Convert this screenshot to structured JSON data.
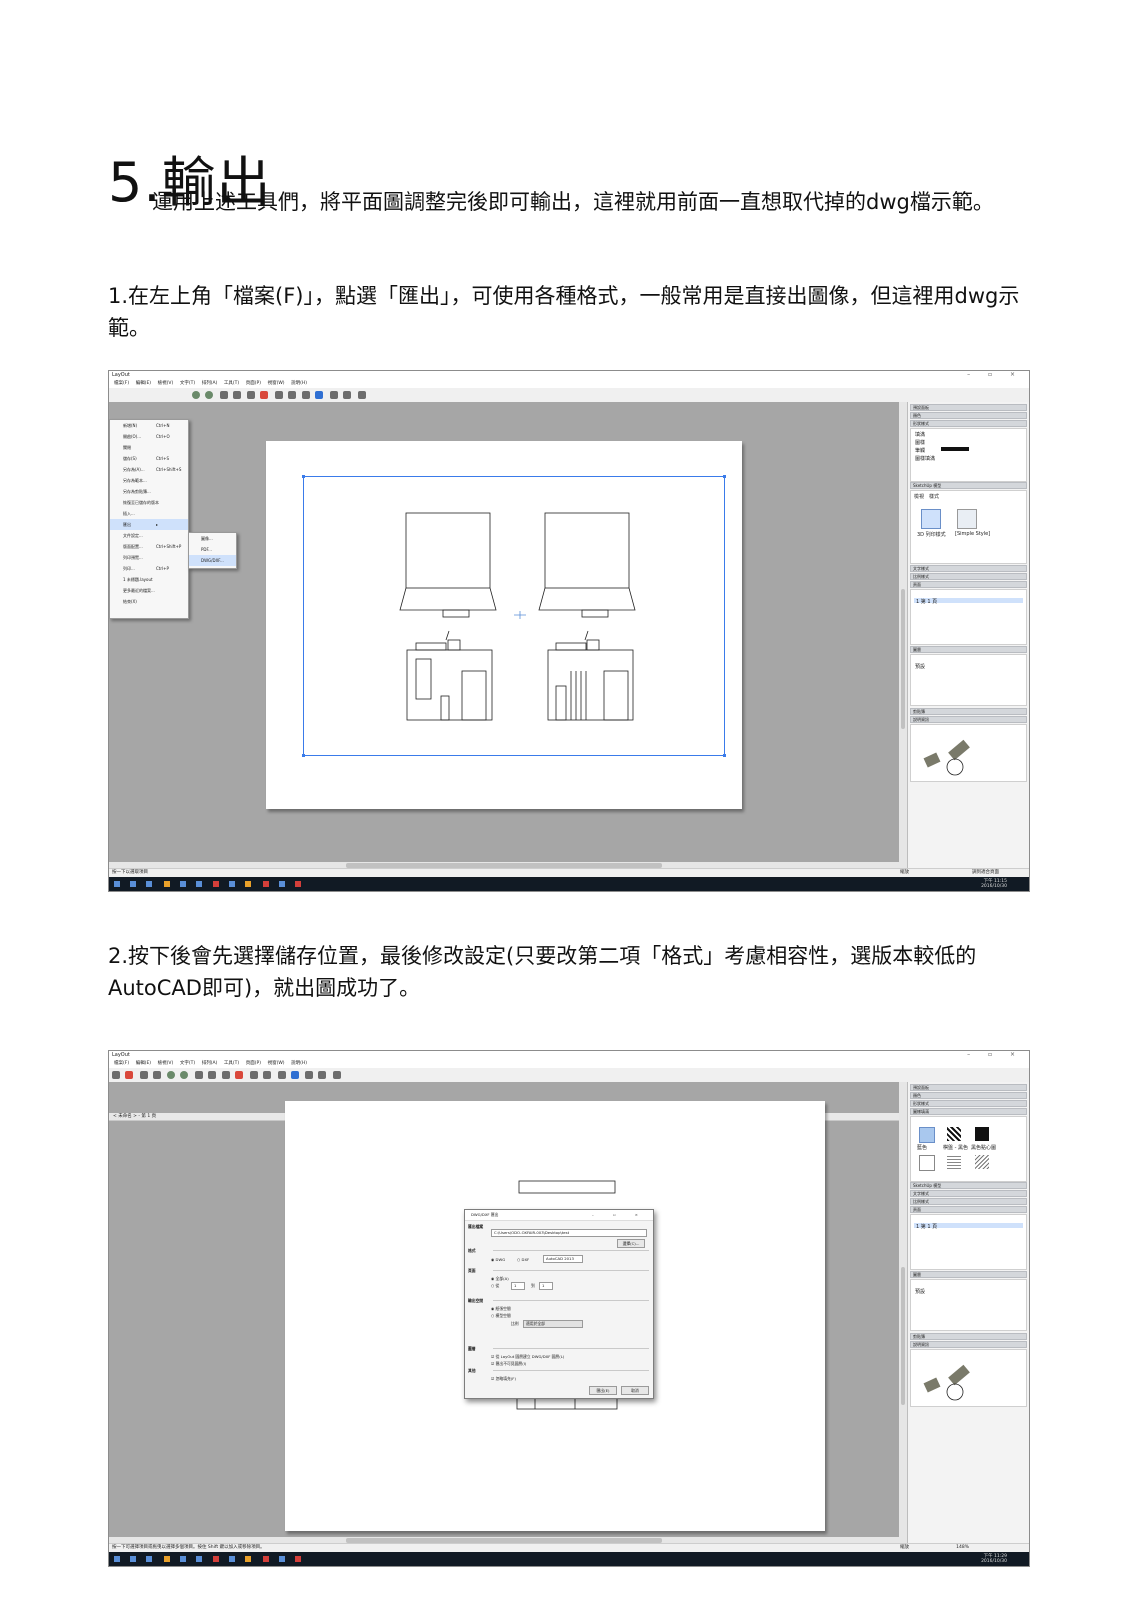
{
  "heading": "5.輸出",
  "paragraphs": {
    "intro": "運用上述工具們，將平面圖調整完後即可輸出，這裡就用前面一直想取代掉的dwg檔示範。",
    "step1": "1.在左上角「檔案(F)」，點選「匯出」，可使用各種格式，一般常用是直接出圖像，但這裡用dwg示範。",
    "step2": "2.按下後會先選擇儲存位置，最後修改設定(只要改第二項「格式」考慮相容性，選版本較低的AutoCAD即可)，就出圖成功了。"
  },
  "screenshot1": {
    "app_title": "LayOut",
    "menu": [
      "檔案(F)",
      "編輯(E)",
      "檢視(V)",
      "文字(T)",
      "排列(A)",
      "工具(T)",
      "頁面(P)",
      "視窗(W)",
      "說明(H)"
    ],
    "file_menu": [
      {
        "label": "新增(N)",
        "shortcut": "Ctrl+N"
      },
      {
        "label": "開啟(O)...",
        "shortcut": "Ctrl+O"
      },
      {
        "label": "關閉",
        "shortcut": ""
      },
      {
        "label": "儲存(S)",
        "shortcut": "Ctrl+S"
      },
      {
        "label": "另存為(A)...",
        "shortcut": "Ctrl+Shift+S"
      },
      {
        "label": "另存為範本...",
        "shortcut": ""
      },
      {
        "label": "另存為剪貼簿...",
        "shortcut": ""
      },
      {
        "label": "恢復至已儲存的版本",
        "shortcut": ""
      },
      {
        "label": "插入...",
        "shortcut": ""
      },
      {
        "label": "匯出",
        "shortcut": "▸"
      },
      {
        "label": "文件設定...",
        "shortcut": ""
      },
      {
        "label": "版面配置...",
        "shortcut": "Ctrl+Shift+P"
      },
      {
        "label": "列印預覽...",
        "shortcut": ""
      },
      {
        "label": "列印...",
        "shortcut": "Ctrl+P"
      },
      {
        "label": "1 未標題.layout",
        "shortcut": ""
      },
      {
        "label": "更多最近的檔案...",
        "shortcut": ""
      },
      {
        "label": "結束(X)",
        "shortcut": ""
      }
    ],
    "export_submenu": [
      "圖像...",
      "PDF...",
      "DWG/DXF..."
    ],
    "status_left": "按一下以選取項目",
    "zoom_label": "縮放",
    "zoom_value": "調到適合頁面",
    "clock_time": "下午 11:15",
    "clock_date": "2016/10/30",
    "panel_headers": [
      "預設面板",
      "顏色",
      "形狀樣式",
      "填滿",
      "圖樣",
      "筆觸",
      "圖樣填滿",
      "SketchUp 模型",
      "檢視",
      "樣式",
      "文字樣式",
      "比例樣式",
      "頁面",
      "圖層",
      "剪貼簿",
      "說明資訊"
    ],
    "model_styles": [
      "3D 列印樣式",
      "[Simple Style]"
    ],
    "page_list": [
      "1  第 1 頁"
    ],
    "layer_list": [
      "預設"
    ]
  },
  "screenshot2": {
    "app_title": "LayOut",
    "tab_label": "< 未命名 > - 第 1 頁",
    "dialog_title": "DWG/DXF 匯出",
    "save_label": "匯出檔案",
    "save_path": "C:\\Users\\ODO-OXFAIR-003\\Desktop\\test",
    "choose_button": "選擇(C)...",
    "format_label": "格式",
    "format_options": [
      "DWG",
      "DXF"
    ],
    "format_version": "AutoCAD 2013",
    "pages_label": "頁面",
    "pages_all": "全部(A)",
    "pages_from": "從",
    "pages_from_value": "1",
    "pages_to": "到",
    "pages_to_value": "1",
    "output_label": "輸出空間",
    "output_paper": "紙張空間",
    "output_model": "模型空間",
    "scale_label": "比例",
    "scale_value": "適用於全部",
    "layers_label": "圖層",
    "layer_opt1": "從 LayOut 圖層建立 DWG/DXF 圖層(L)",
    "layer_opt2": "匯出不可見圖層(I)",
    "other_label": "其他",
    "other_opt": "忽略填充(F)",
    "export_button": "匯出(E)",
    "cancel_button": "取消",
    "status_left": "按一下可選擇項目或拖曳以選擇多個項目。按住 Shift 鍵以加入或移除項目。",
    "zoom_label": "縮放",
    "zoom_value": "148%",
    "clock_time": "下午 11:29",
    "clock_date": "2016/10/30",
    "pattern_labels": [
      "藍色",
      "棋盤 - 黑色",
      "黑色點心圖"
    ],
    "page_list": [
      "1  第 1 頁"
    ],
    "layer_list": [
      "預設"
    ]
  }
}
